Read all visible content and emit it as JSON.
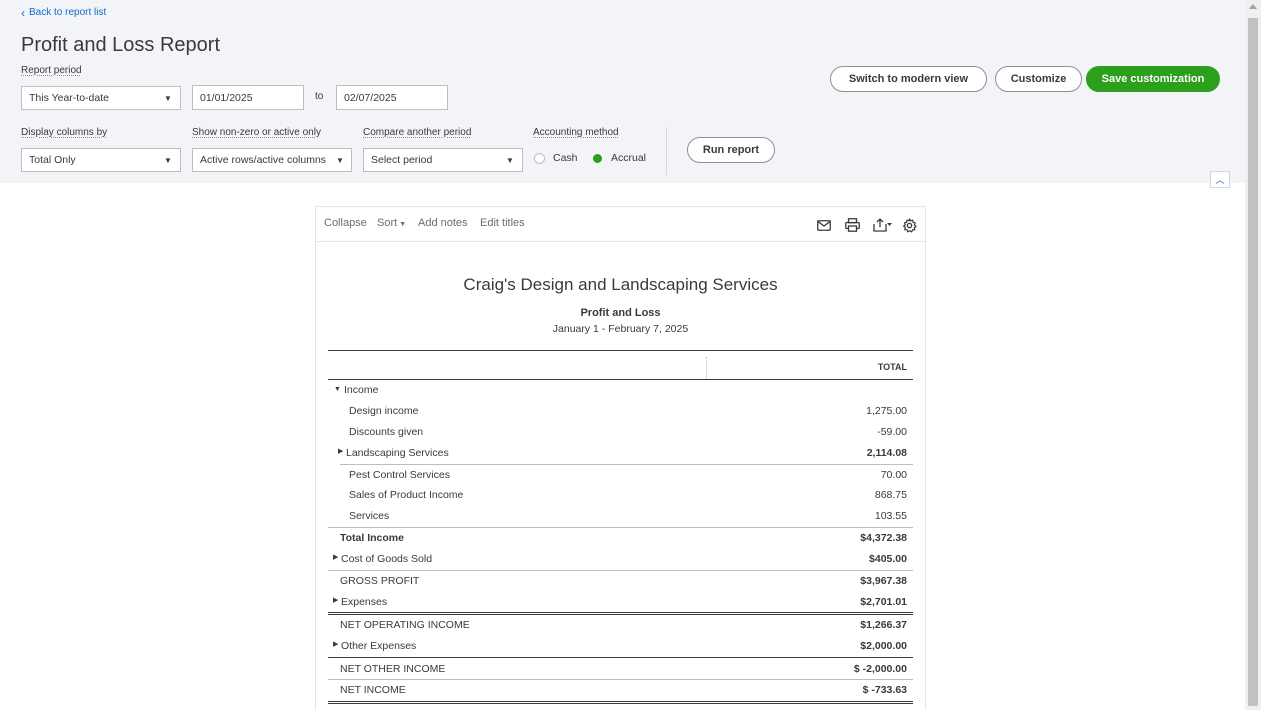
{
  "header": {
    "back_link": "Back to report list",
    "title": "Profit and Loss Report"
  },
  "filters": {
    "report_period_label": "Report period",
    "report_period_value": "This Year-to-date",
    "date_from": "01/01/2025",
    "to_label": "to",
    "date_to": "02/07/2025",
    "display_columns_label": "Display columns by",
    "display_columns_value": "Total Only",
    "non_zero_label": "Show non-zero or active only",
    "non_zero_value": "Active rows/active columns",
    "compare_label": "Compare another period",
    "compare_value": "Select period",
    "accounting_label": "Accounting method",
    "cash_label": "Cash",
    "accrual_label": "Accrual",
    "selected_method": "Accrual"
  },
  "actions": {
    "switch_modern": "Switch to modern view",
    "customize": "Customize",
    "save_customization": "Save customization",
    "run_report": "Run report"
  },
  "toolbar": {
    "collapse": "Collapse",
    "sort": "Sort",
    "add_notes": "Add notes",
    "edit_titles": "Edit titles",
    "icons": [
      "email-icon",
      "print-icon",
      "export-icon",
      "settings-icon"
    ]
  },
  "report": {
    "company": "Craig's Design and Landscaping Services",
    "title": "Profit and Loss",
    "date_range": "January 1 - February 7, 2025",
    "column_header": "TOTAL",
    "rows": [
      {
        "label": "Income",
        "value": "",
        "caret": "down"
      },
      {
        "label": "Design income",
        "value": "1,275.00"
      },
      {
        "label": "Discounts given",
        "value": "-59.00"
      },
      {
        "label": "Landscaping Services",
        "value": "2,114.08",
        "caret": "right"
      },
      {
        "label": "Pest Control Services",
        "value": "70.00"
      },
      {
        "label": "Sales of Product Income",
        "value": "868.75"
      },
      {
        "label": "Services",
        "value": "103.55"
      },
      {
        "label": "Total Income",
        "value": "$4,372.38"
      },
      {
        "label": "Cost of Goods Sold",
        "value": "$405.00",
        "caret": "right"
      },
      {
        "label": "GROSS PROFIT",
        "value": "$3,967.38"
      },
      {
        "label": "Expenses",
        "value": "$2,701.01",
        "caret": "right"
      },
      {
        "label": "NET OPERATING INCOME",
        "value": "$1,266.37"
      },
      {
        "label": "Other Expenses",
        "value": "$2,000.00",
        "caret": "right"
      },
      {
        "label": "NET OTHER INCOME",
        "value": "$ -2,000.00"
      },
      {
        "label": "NET INCOME",
        "value": "$ -733.63"
      }
    ]
  },
  "colors": {
    "accent_green": "#2ca01c",
    "link_blue": "#0d6acb",
    "header_bg": "#f3f4f7"
  }
}
